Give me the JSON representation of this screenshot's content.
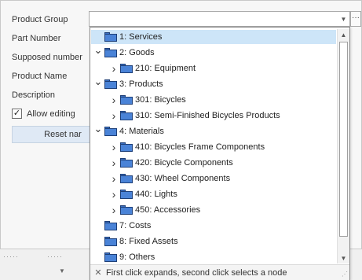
{
  "form": {
    "labels": {
      "product_group": "Product Group",
      "part_number": "Part Number",
      "supposed_number": "Supposed number",
      "product_name": "Product Name",
      "description": "Description"
    },
    "allow_editing_label": "Allow editing",
    "allow_editing_checked": true,
    "reset_button_label": "Reset nar"
  },
  "combo": {
    "value": "",
    "ellipsis": "···"
  },
  "tree": {
    "nodes": [
      {
        "label": "1: Services",
        "selected": true,
        "expander": "none",
        "level": 0
      },
      {
        "label": "2: Goods",
        "expander": "expanded",
        "level": 0
      },
      {
        "label": "210: Equipment",
        "expander": "collapsed",
        "level": 1
      },
      {
        "label": "3: Products",
        "expander": "expanded",
        "level": 0
      },
      {
        "label": "301: Bicycles",
        "expander": "collapsed",
        "level": 1
      },
      {
        "label": "310: Semi-Finished Bicycles Products",
        "expander": "collapsed",
        "level": 1
      },
      {
        "label": "4: Materials",
        "expander": "expanded",
        "level": 0
      },
      {
        "label": "410: Bicycles Frame Components",
        "expander": "collapsed",
        "level": 1
      },
      {
        "label": "420: Bicycle Components",
        "expander": "collapsed",
        "level": 1
      },
      {
        "label": "430: Wheel Components",
        "expander": "collapsed",
        "level": 1
      },
      {
        "label": "440: Lights",
        "expander": "collapsed",
        "level": 1
      },
      {
        "label": "450: Accessories",
        "expander": "collapsed",
        "level": 1
      },
      {
        "label": "7: Costs",
        "expander": "none",
        "level": 0
      },
      {
        "label": "8: Fixed Assets",
        "expander": "none",
        "level": 0
      },
      {
        "label": "9: Others",
        "expander": "none",
        "level": 0
      }
    ]
  },
  "footer": {
    "hint": "First click expands, second click selects a node",
    "close_glyph": "✕"
  },
  "colors": {
    "selection": "#cde5f8",
    "folder": "#4a83d7",
    "reset_button": "#dfe9f5"
  }
}
